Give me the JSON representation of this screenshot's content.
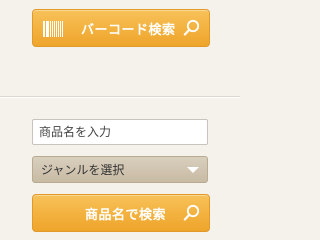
{
  "barcode_search": {
    "label": "バーコード検索",
    "icon": "barcode-icon",
    "search_icon": "search-icon"
  },
  "product_name_input": {
    "placeholder": "商品名を入力",
    "value": ""
  },
  "genre_select": {
    "selected": "ジャンルを選択",
    "icon": "chevron-down-icon"
  },
  "product_name_search": {
    "label": "商品名で検索",
    "search_icon": "search-icon"
  },
  "colors": {
    "accent": "#f3b13e",
    "background": "#f5f2ec",
    "select": "#cfc3ae"
  }
}
